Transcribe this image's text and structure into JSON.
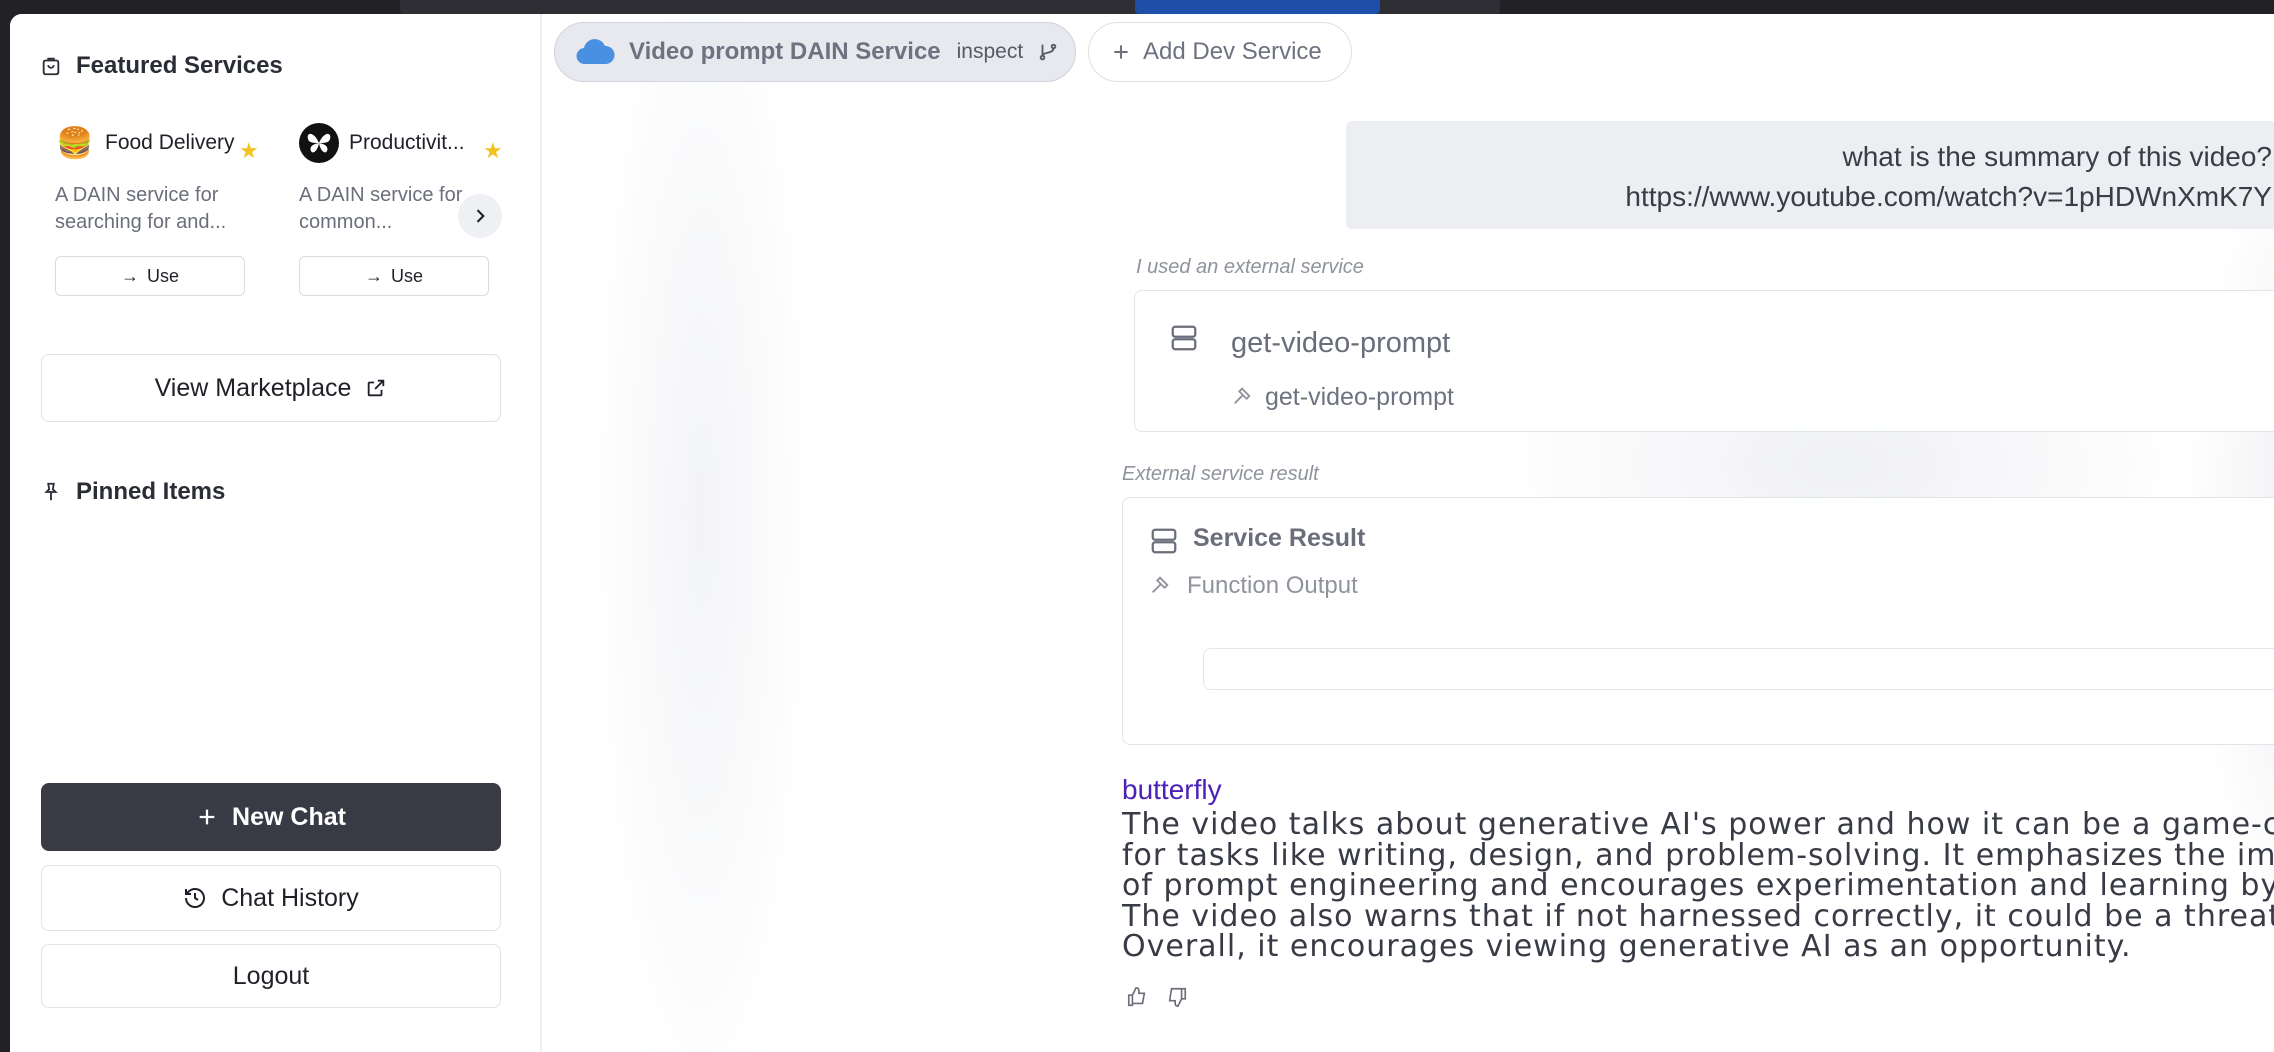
{
  "sidebar": {
    "featured_title": "Featured Services",
    "pinned_title": "Pinned Items",
    "cards": [
      {
        "name": "Food Delivery",
        "logo": "🍔",
        "desc": "A DAIN service for searching for and...",
        "use_label": "Use"
      },
      {
        "name": "Productivit...",
        "logo": "butterfly-logo",
        "desc": "A DAIN service for common...",
        "use_label": "Use"
      }
    ],
    "view_marketplace": "View Marketplace",
    "new_chat": "New Chat",
    "chat_history": "Chat History",
    "logout": "Logout"
  },
  "main": {
    "service_chip": "Video prompt DAIN Service",
    "inspect_label": "inspect",
    "add_dev_service": "Add Dev Service",
    "user_message_line1": "what is the summary of this video?",
    "user_message_line2": "https://www.youtube.com/watch?v=1pHDWnXmK7Y",
    "external_caption": "I used an external service",
    "tool_title": "get-video-prompt",
    "tool_sub": "get-video-prompt",
    "result_caption": "External service result",
    "result_title": "Service Result",
    "result_sub": "Function Output",
    "assistant_name": "butterfly",
    "assistant_text": "The video talks about generative AI's power and how it can be a game-changer for tasks like writing, design, and problem-solving. It emphasizes the importance of prompt engineering and encourages experimentation and learning by doing. The video also warns that if not harnessed correctly, it could be a threat. Overall, it encourages viewing generative AI as an opportunity."
  },
  "colors": {
    "accent_name": "#4b21b8",
    "new_chat_bg": "#383a46",
    "star": "#f4c321",
    "cloud": "#4a90e2"
  },
  "icons": [
    "bag-icon",
    "pin-icon",
    "arrow-right-icon",
    "chevron-right-icon",
    "external-link-icon",
    "plus-icon",
    "history-icon",
    "cloud-icon",
    "git-branch-icon",
    "database-icon",
    "hammer-icon",
    "thumbs-up-icon",
    "thumbs-down-icon"
  ]
}
